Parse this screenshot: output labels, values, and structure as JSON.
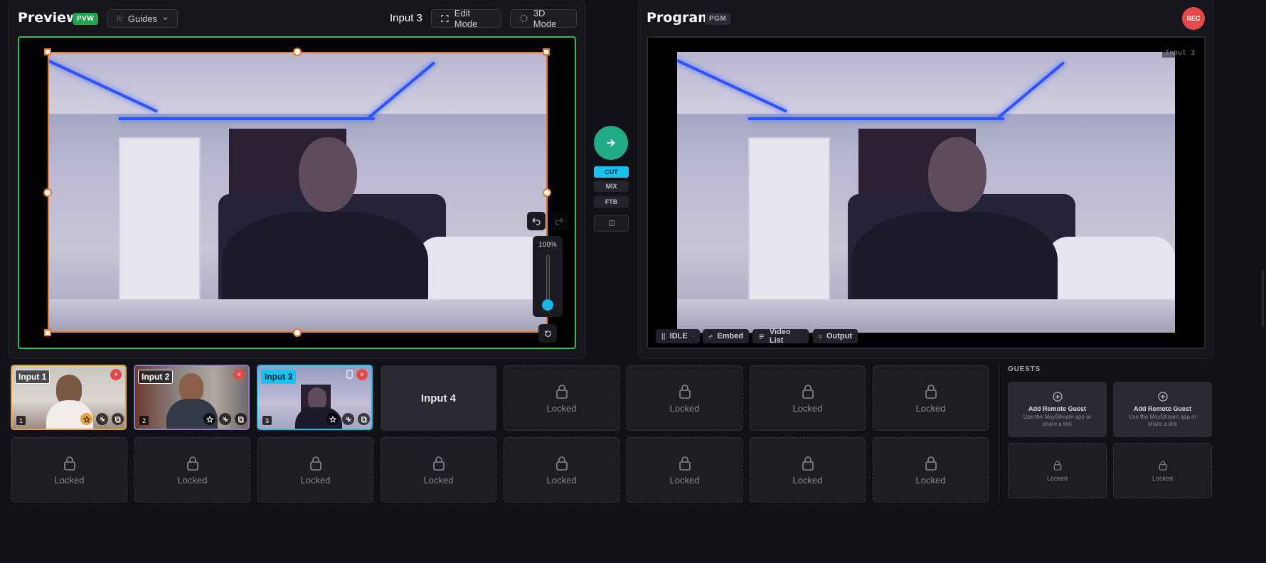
{
  "preview": {
    "title": "Preview",
    "badge": "PVW",
    "guides_label": "Guides",
    "active_input": "Input 3",
    "edit_mode_label": "Edit Mode",
    "mode_3d_label": "3D Mode",
    "zoom": "100%",
    "frame_color": "#2fbf4f",
    "selection_color": "#e8792c"
  },
  "transition": {
    "cut": "CUT",
    "mix": "MIX",
    "ftb": "FTB",
    "active": "CUT",
    "accent": "#17c3ef"
  },
  "program": {
    "title": "Program",
    "badge": "PGM",
    "rec_label": "REC",
    "rec_color": "#e54a4a",
    "input_tag": "Input 3",
    "status": "IDLE",
    "embed_label": "Embed",
    "video_list_label": "Video List",
    "output_label": "Output"
  },
  "inputs": {
    "row1": [
      {
        "name": "Input 1",
        "number": "1",
        "border": "#e8a13b"
      },
      {
        "name": "Input 2",
        "number": "2",
        "border": "#8c7cc4"
      },
      {
        "name": "Input 3",
        "number": "3",
        "border": "#17c3ef"
      },
      {
        "name": "Input 4"
      },
      {
        "locked": "Locked"
      },
      {
        "locked": "Locked"
      },
      {
        "locked": "Locked"
      },
      {
        "locked": "Locked"
      }
    ],
    "row2": [
      "Locked",
      "Locked",
      "Locked",
      "Locked",
      "Locked",
      "Locked",
      "Locked",
      "Locked"
    ]
  },
  "guests": {
    "heading": "GUESTS",
    "slots": [
      {
        "title": "Add Remote Guest",
        "subtitle": "Use the MoyStream app or share a link"
      },
      {
        "title": "Add Remote Guest",
        "subtitle": "Use the MoyStream app or share a link"
      }
    ],
    "locked": [
      "Locked",
      "Locked"
    ]
  }
}
